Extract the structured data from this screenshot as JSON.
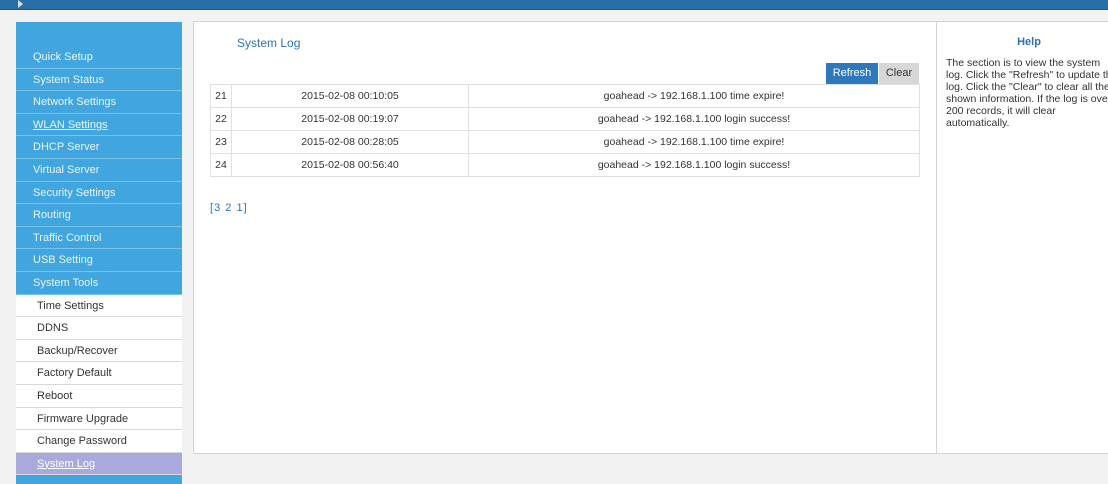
{
  "sidebar": {
    "items": [
      {
        "label": "Quick Setup"
      },
      {
        "label": "System Status"
      },
      {
        "label": "Network Settings"
      },
      {
        "label": "WLAN Settings"
      },
      {
        "label": "DHCP Server"
      },
      {
        "label": "Virtual Server"
      },
      {
        "label": "Security Settings"
      },
      {
        "label": "Routing"
      },
      {
        "label": "Traffic Control"
      },
      {
        "label": "USB Setting"
      },
      {
        "label": "System Tools"
      }
    ],
    "submenu": [
      {
        "label": "Time Settings"
      },
      {
        "label": "DDNS"
      },
      {
        "label": "Backup/Recover"
      },
      {
        "label": "Factory Default"
      },
      {
        "label": "Reboot"
      },
      {
        "label": "Firmware Upgrade"
      },
      {
        "label": "Change Password"
      },
      {
        "label": "System Log"
      }
    ],
    "active_item": "System Log"
  },
  "main": {
    "title": "System Log",
    "refresh_label": "Refresh",
    "clear_label": "Clear",
    "rows": [
      {
        "id": "21",
        "time": "2015-02-08 00:10:05",
        "message": "goahead -> 192.168.1.100 time expire!"
      },
      {
        "id": "22",
        "time": "2015-02-08 00:19:07",
        "message": "goahead -> 192.168.1.100 login success!"
      },
      {
        "id": "23",
        "time": "2015-02-08 00:28:05",
        "message": "goahead -> 192.168.1.100 time expire!"
      },
      {
        "id": "24",
        "time": "2015-02-08 00:56:40",
        "message": "goahead -> 192.168.1.100 login success!"
      }
    ],
    "pager": {
      "open": "[",
      "pages": [
        "3",
        "2",
        "1"
      ],
      "close": "]"
    }
  },
  "help": {
    "title": "Help",
    "lines": [
      "The section is to view the system",
      "log. Click the \"Refresh\" to update the",
      "log. Click the \"Clear\" to clear all the",
      "shown information. If the log is over",
      "200 records, it will clear",
      "automatically."
    ]
  },
  "colors": {
    "topbar": "#2a6ea6",
    "sidebar": "#41a6df",
    "active_item": "#a9a9dc",
    "refresh_button": "#2e78bd",
    "clear_button": "#d7d7d7",
    "link": "#2d73b4"
  }
}
